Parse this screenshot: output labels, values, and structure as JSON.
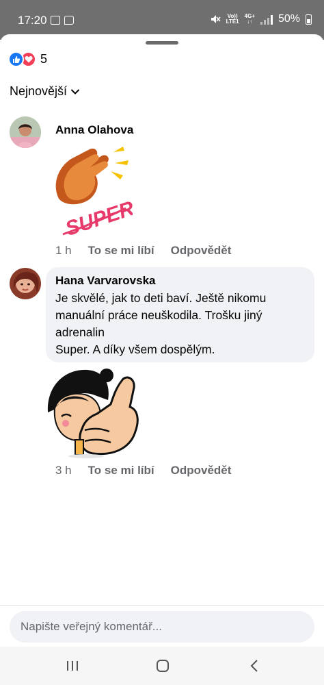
{
  "status_bar": {
    "time": "17:20",
    "network_top": "Vo))",
    "network_bottom": "LTE1",
    "network2_top": "4G+",
    "network2_bottom": "↓↑",
    "battery": "50%"
  },
  "reactions": {
    "count": "5",
    "types": [
      "like-icon",
      "love-icon"
    ]
  },
  "sort": {
    "label": "Nejnovější"
  },
  "comments": [
    {
      "author": "Anna Olahova",
      "sticker_text": "SUPER!",
      "time": "1 h",
      "like": "To se mi líbí",
      "reply": "Odpovědět"
    },
    {
      "author": "Hana Varvarovska",
      "text": "Je skvělé, jak to deti baví. Ještě nikomu\nmanuální práce neuškodila. Trošku jiný\nadrenalin\nSuper. A díky všem dospělým.",
      "time": "3 h",
      "like": "To se mi líbí",
      "reply": "Odpovědět"
    }
  ],
  "composer": {
    "placeholder": "Napište veřejný komentář..."
  },
  "colors": {
    "like": "#1877f2",
    "love": "#f33e58",
    "bubble": "#f0f2f5",
    "meta": "#65676b"
  }
}
